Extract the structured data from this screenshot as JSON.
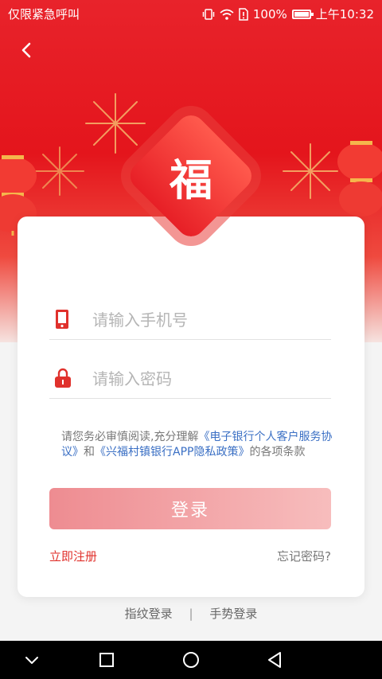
{
  "status_bar": {
    "left_text": "仅限紧急呼叫",
    "battery": "100%",
    "time": "上午10:32",
    "icons": [
      "vibrate-icon",
      "wifi-icon",
      "sim-alert-icon",
      "battery-icon"
    ]
  },
  "logo": {
    "char": "福"
  },
  "login": {
    "phone_placeholder": "请输入手机号",
    "password_placeholder": "请输入密码",
    "agreement": {
      "text1": "请您务必审慎阅读,充分理解",
      "link1": "《电子银行个人客户服务协议》",
      "text2": "和",
      "link2": "《兴福村镇银行APP隐私政策》",
      "text3": "的各项条款"
    },
    "submit_label": "登录",
    "register_label": "立即注册",
    "forgot_label": "忘记密码?"
  },
  "alt_login": {
    "fingerprint_label": "指纹登录",
    "separator": "|",
    "gesture_label": "手势登录"
  },
  "colors": {
    "brand_red": "#e4151c",
    "link_blue": "#3a6fc4",
    "button_pink": "#f2a5a8"
  }
}
